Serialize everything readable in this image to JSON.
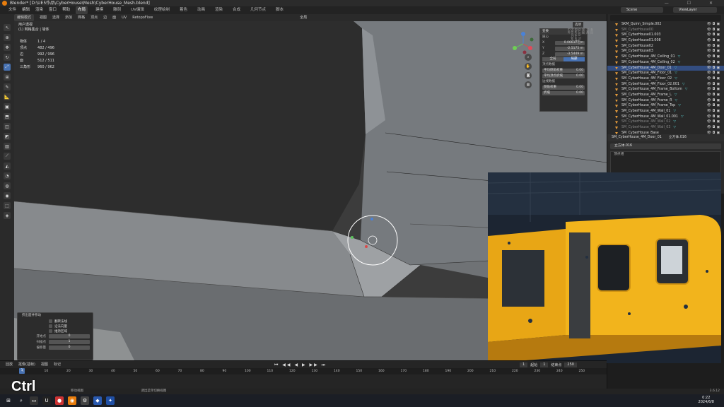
{
  "window": {
    "title": "Blender* [D:\\UE5作品\\CyberHouse\\Mesh\\CyberHouse_Mesh.blend]",
    "controls": [
      "—",
      "☐",
      "✕"
    ]
  },
  "menubar": {
    "items": [
      "文件",
      "编辑",
      "渲染",
      "窗口",
      "帮助"
    ],
    "workspaces": [
      "布局",
      "建模",
      "雕刻",
      "UV编辑",
      "纹理绘制",
      "着色",
      "动画",
      "渲染",
      "合成",
      "几何节点",
      "脚本"
    ],
    "active_workspace": "布局"
  },
  "scene": {
    "label": "Scene",
    "view_layer": "ViewLayer"
  },
  "header": {
    "mode": "编辑模式",
    "items": [
      "视图",
      "选择",
      "添加",
      "网格",
      "顶点",
      "边",
      "面",
      "UV",
      "RetopoFlow"
    ],
    "transform": "全局"
  },
  "viewport": {
    "view_name": "用户透视",
    "object_name": "(1) 网格集合 | 墙体",
    "stats": [
      {
        "label": "物体",
        "value": "1 / 4"
      },
      {
        "label": "顶点",
        "value": "482 / 496"
      },
      {
        "label": "边",
        "value": "992 / 996"
      },
      {
        "label": "面",
        "value": "512 / 511"
      },
      {
        "label": "三角形",
        "value": "960 / 962"
      }
    ]
  },
  "npanel": {
    "view_mode": "选项",
    "section": "变换",
    "subsection": "质心",
    "x": {
      "label": "X",
      "value": "0.066177 m"
    },
    "y": {
      "label": "Y",
      "value": "-2.5175 m"
    },
    "z": {
      "label": "Z",
      "value": "-3.5449 m"
    },
    "seg": [
      "全局",
      "局部"
    ],
    "seg_active": "局部",
    "vertex_data": "顶点数据",
    "bevel_weight": {
      "label": "平均倒角权重",
      "value": "0.00"
    },
    "crease": {
      "label": "平均顶点折痕",
      "value": "0.00"
    },
    "edge_data": "边线数据",
    "edge_bevel": {
      "label": "倒角权重",
      "value": "0.00"
    },
    "edge_crease": {
      "label": "折痕",
      "value": "0.00"
    },
    "tabs": [
      "条目",
      "工具",
      "视图",
      "Quick Tools",
      "BlenderKit",
      "HardOps",
      "Edit"
    ]
  },
  "redo": {
    "title": "挤出面并移动",
    "checks": [
      "翻转法线",
      "沿法向量",
      "维持区域"
    ],
    "rows": [
      {
        "label": "开始点",
        "value": "0"
      },
      {
        "label": "扫描点",
        "value": "1"
      },
      {
        "label": "偏移量",
        "value": "0"
      }
    ]
  },
  "outliner": {
    "items": [
      {
        "name": "SKM_Quinn_Simple.002",
        "tag": "",
        "dim": false,
        "sel": false
      },
      {
        "name": "SM_CyberHouse00",
        "tag": "",
        "dim": true,
        "sel": false
      },
      {
        "name": "SM_CyberHouse01.003",
        "tag": "",
        "dim": false,
        "sel": false
      },
      {
        "name": "SM_CyberHouse01.008",
        "tag": "",
        "dim": false,
        "sel": false
      },
      {
        "name": "SM_CyberHouse02",
        "tag": "",
        "dim": false,
        "sel": false
      },
      {
        "name": "SM_CyberHouse03",
        "tag": "",
        "dim": false,
        "sel": false
      },
      {
        "name": "SM_CyberHouse_4M_Ceiling_01",
        "tag": "▽",
        "dim": false,
        "sel": false
      },
      {
        "name": "SM_CyberHouse_4M_Ceiling_02",
        "tag": "▽",
        "dim": false,
        "sel": false
      },
      {
        "name": "SM_CyberHouse_4M_Door_01",
        "tag": "▽",
        "dim": false,
        "sel": true
      },
      {
        "name": "SM_CyberHouse_4M_Floor_01",
        "tag": "▽",
        "dim": false,
        "sel": false
      },
      {
        "name": "SM_CyberHouse_4M_Floor_02",
        "tag": "▽",
        "dim": false,
        "sel": false
      },
      {
        "name": "SM_CyberHouse_4M_Floor_02.001",
        "tag": "▽",
        "dim": false,
        "sel": false
      },
      {
        "name": "SM_CyberHouse_4M_Frame_Bottom",
        "tag": "▽",
        "dim": false,
        "sel": false
      },
      {
        "name": "SM_CyberHouse_4M_Frame_L",
        "tag": "▽",
        "dim": false,
        "sel": false
      },
      {
        "name": "SM_CyberHouse_4M_Frame_R",
        "tag": "▽",
        "dim": false,
        "sel": false
      },
      {
        "name": "SM_CyberHouse_4M_Frame_Top",
        "tag": "▽",
        "dim": false,
        "sel": false
      },
      {
        "name": "SM_CyberHouse_4M_Wall_01",
        "tag": "▽",
        "dim": false,
        "sel": false
      },
      {
        "name": "SM_CyberHouse_4M_Wall_01.001",
        "tag": "▽",
        "dim": false,
        "sel": false
      },
      {
        "name": "SM_CyberHouse_4M_Wall_02",
        "tag": "▽",
        "dim": true,
        "sel": false
      },
      {
        "name": "SM_CyberHouse_4M_Wall_03",
        "tag": "▽",
        "dim": true,
        "sel": false
      },
      {
        "name": "SM_CyberHouse_Base",
        "tag": "",
        "dim": false,
        "sel": false
      }
    ]
  },
  "properties": {
    "object": "SM_CyberHouse_4M_Door_01",
    "mesh": "立方体.016",
    "mesh_field": "立方体.016",
    "panel": "顶点组"
  },
  "timeline": {
    "menus": [
      "回放",
      "抠像(插帧)",
      "视图",
      "标记"
    ],
    "controls": "⏮ ◀◀ ◀ ▶ ▶▶ ⏭",
    "current_frame": "1",
    "start_label": "起始",
    "start": "1",
    "end_label": "结束点",
    "end": "250",
    "ruler": [
      "1",
      "10",
      "20",
      "30",
      "40",
      "50",
      "60",
      "70",
      "80",
      "90",
      "100",
      "110",
      "120",
      "130",
      "140",
      "150",
      "160",
      "170",
      "180",
      "190",
      "200",
      "210",
      "220",
      "230",
      "240",
      "250"
    ]
  },
  "status": {
    "left": "移动视图",
    "middle": "调出菜单切换视图",
    "version": "3.6.12"
  },
  "overlay_key": "Ctrl",
  "clock": {
    "time": "0:22",
    "date": "2024/6/8"
  }
}
